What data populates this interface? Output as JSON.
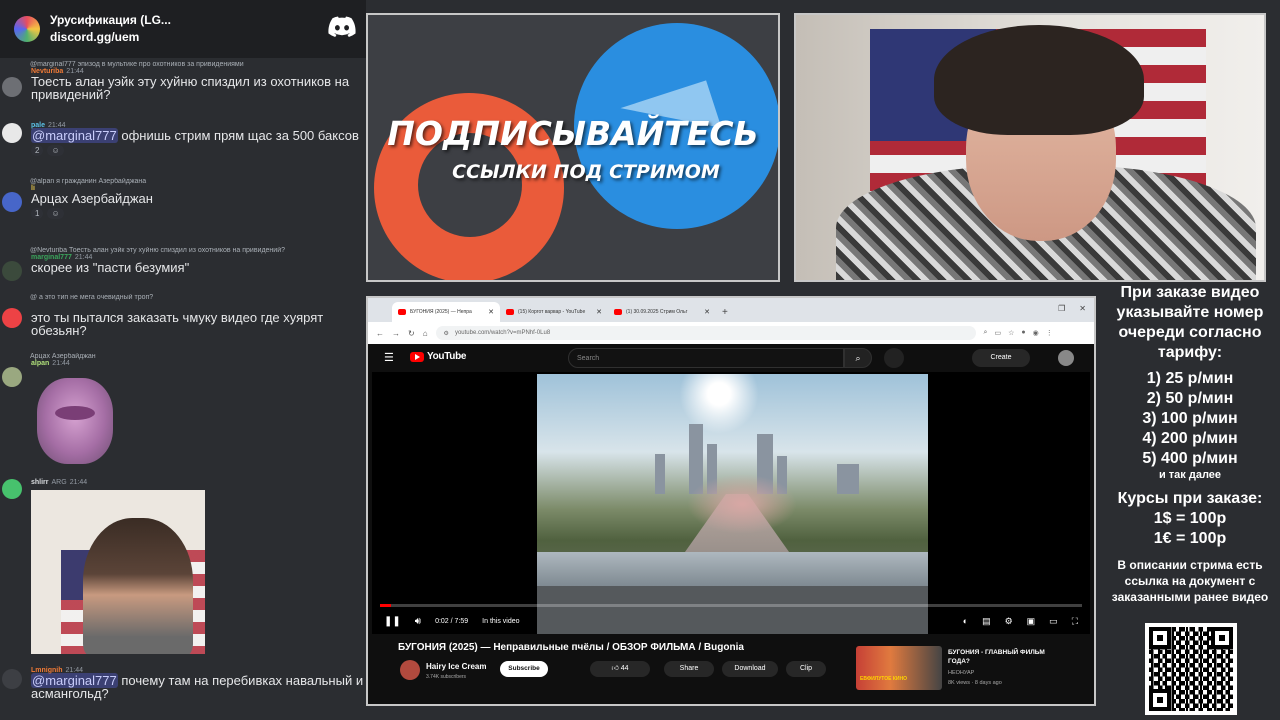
{
  "discord": {
    "server_name": "Урусификация (LG...",
    "invite": "discord.gg/uem",
    "messages": [
      {
        "reply": "@marginal777 эпизод в мультике про охотников за привидениями",
        "name": "Nevturiba",
        "name_color": "#f07a36",
        "time": "21:44",
        "text": "Тоесть алан уэйк эту хуйню спиздил из охотников на привидений?"
      },
      {
        "name": "pale",
        "name_color": "#5bc2e7",
        "time": "21:44",
        "mention": "@marginal777",
        "text": " офнишь стрим прям щас за 500 баксов",
        "reactions": [
          "2",
          "☺"
        ]
      },
      {
        "reply": "@alpan я гражданин Азербайджана",
        "name": "li",
        "name_color": "#e6c64b",
        "time": "",
        "text": "Арцах Азербайджан",
        "reactions": [
          "1",
          "☺"
        ]
      },
      {
        "reply": "@Nevturiba Тоесть алан уэйк эту хуйню спиздил из охотников на привидений?",
        "name": "marginal777",
        "name_color": "#3ba55c",
        "time": "21:44",
        "text": "скорее из \"пасти безумия\""
      },
      {
        "reply": "@ а это тип не мега очевидный троп?",
        "name": "",
        "name_color": "#ed4245",
        "time": "",
        "text": "это ты пытался заказать чмуку видео где хуярят обезьян?"
      },
      {
        "reply": "Арцах Азербайджан",
        "name": "alpan",
        "name_color": "#b0e07a",
        "time": "21:44",
        "text": ""
      },
      {
        "name": "shlirr",
        "name_color": "#e6e7e9",
        "time": "21:44",
        "badge": "ARG",
        "text": ""
      },
      {
        "name": "Lmnignih",
        "name_color": "#f07a36",
        "time": "21:44",
        "mention": "@marginal777",
        "text": " почему там на перебивках навальный и асмангольд?"
      }
    ]
  },
  "promo": {
    "line1": "ПОДПИСЫВАЙТЕСЬ",
    "line2": "ССЫЛКИ ПОД СТРИМОМ"
  },
  "info": {
    "order_note": "При заказе видео указывайте номер очереди согласно тарифу:",
    "tiers": [
      "1) 25 р/мин",
      "2) 50 р/мин",
      "3) 100 р/мин",
      "4) 200 р/мин",
      "5) 400 р/мин"
    ],
    "etc": "и так далее",
    "rates_title": "Курсы при заказе:",
    "rates": [
      "1$ = 100р",
      "1€ = 100р"
    ],
    "desc_note": "В описании стрима есть ссылка на документ с заказанными ранее видео"
  },
  "browser": {
    "tabs": [
      {
        "label": "БУГОНИЯ (2025) — Непра",
        "active": true
      },
      {
        "label": "(15) Коргот варвар - YouTube",
        "active": false
      },
      {
        "label": "(1) 30.09.2025 Стрим Ольг",
        "active": false
      }
    ],
    "url": "youtube.com/watch?v=mPNhf-0Lu8"
  },
  "youtube": {
    "logo": "YouTube",
    "search_placeholder": "Search",
    "create": "Create",
    "time": "0:02 / 7:59",
    "chapter": "In this video",
    "progress_fraction": 0.004,
    "title": "БУГОНИЯ (2025) — Неправильные пчёлы / ОБЗОР ФИЛЬМА / Bugonia",
    "channel": "Hairy Ice Cream",
    "subscribers": "3.74K subscribers",
    "subscribe": "Subscribe",
    "likes": "44",
    "share": "Share",
    "download": "Download",
    "clip": "Clip",
    "rec_title": "БУГОНИЯ - ГЛАВНЫЙ ФИЛЬМ ГОДА?",
    "rec_channel": "НЕОНУАР",
    "rec_views": "8K views · 8 days ago",
    "rec_badge": "ЕВФИЛУТОЕ КИНО"
  }
}
